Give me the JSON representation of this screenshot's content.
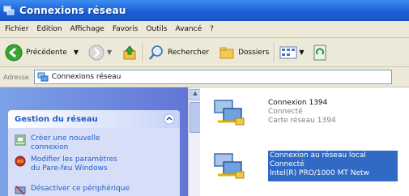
{
  "window": {
    "title": "Connexions réseau"
  },
  "menu": [
    "Fichier",
    "Edition",
    "Affichage",
    "Favoris",
    "Outils",
    "Avancé",
    "?"
  ],
  "toolbar": {
    "back_label": "Précédente",
    "search_label": "Rechercher",
    "folders_label": "Dossiers"
  },
  "address": {
    "label": "Adresse",
    "value": "Connexions réseau"
  },
  "sidebar": {
    "panel_title": "Gestion du réseau",
    "tasks": [
      {
        "label": "Créer une nouvelle connexion",
        "icon": "new-connection-icon"
      },
      {
        "label": "Modifier les paramètres du Pare-feu Windows",
        "icon": "firewall-icon"
      },
      {
        "label": "Désactiver ce périphérique",
        "icon": "disable-device-icon"
      }
    ]
  },
  "connections": [
    {
      "name": "Connexion 1394",
      "status": "Connecté",
      "device": "Carte réseau 1394",
      "selected": false
    },
    {
      "name": "Connexion au réseau local",
      "status": "Connecté",
      "device": "Intel(R) PRO/1000 MT Netw",
      "selected": true
    }
  ],
  "colors": {
    "titlebar": "#1c5fd8",
    "sidebar": "#7ba2e7",
    "selection": "#316ac5",
    "link": "#215dc6"
  }
}
